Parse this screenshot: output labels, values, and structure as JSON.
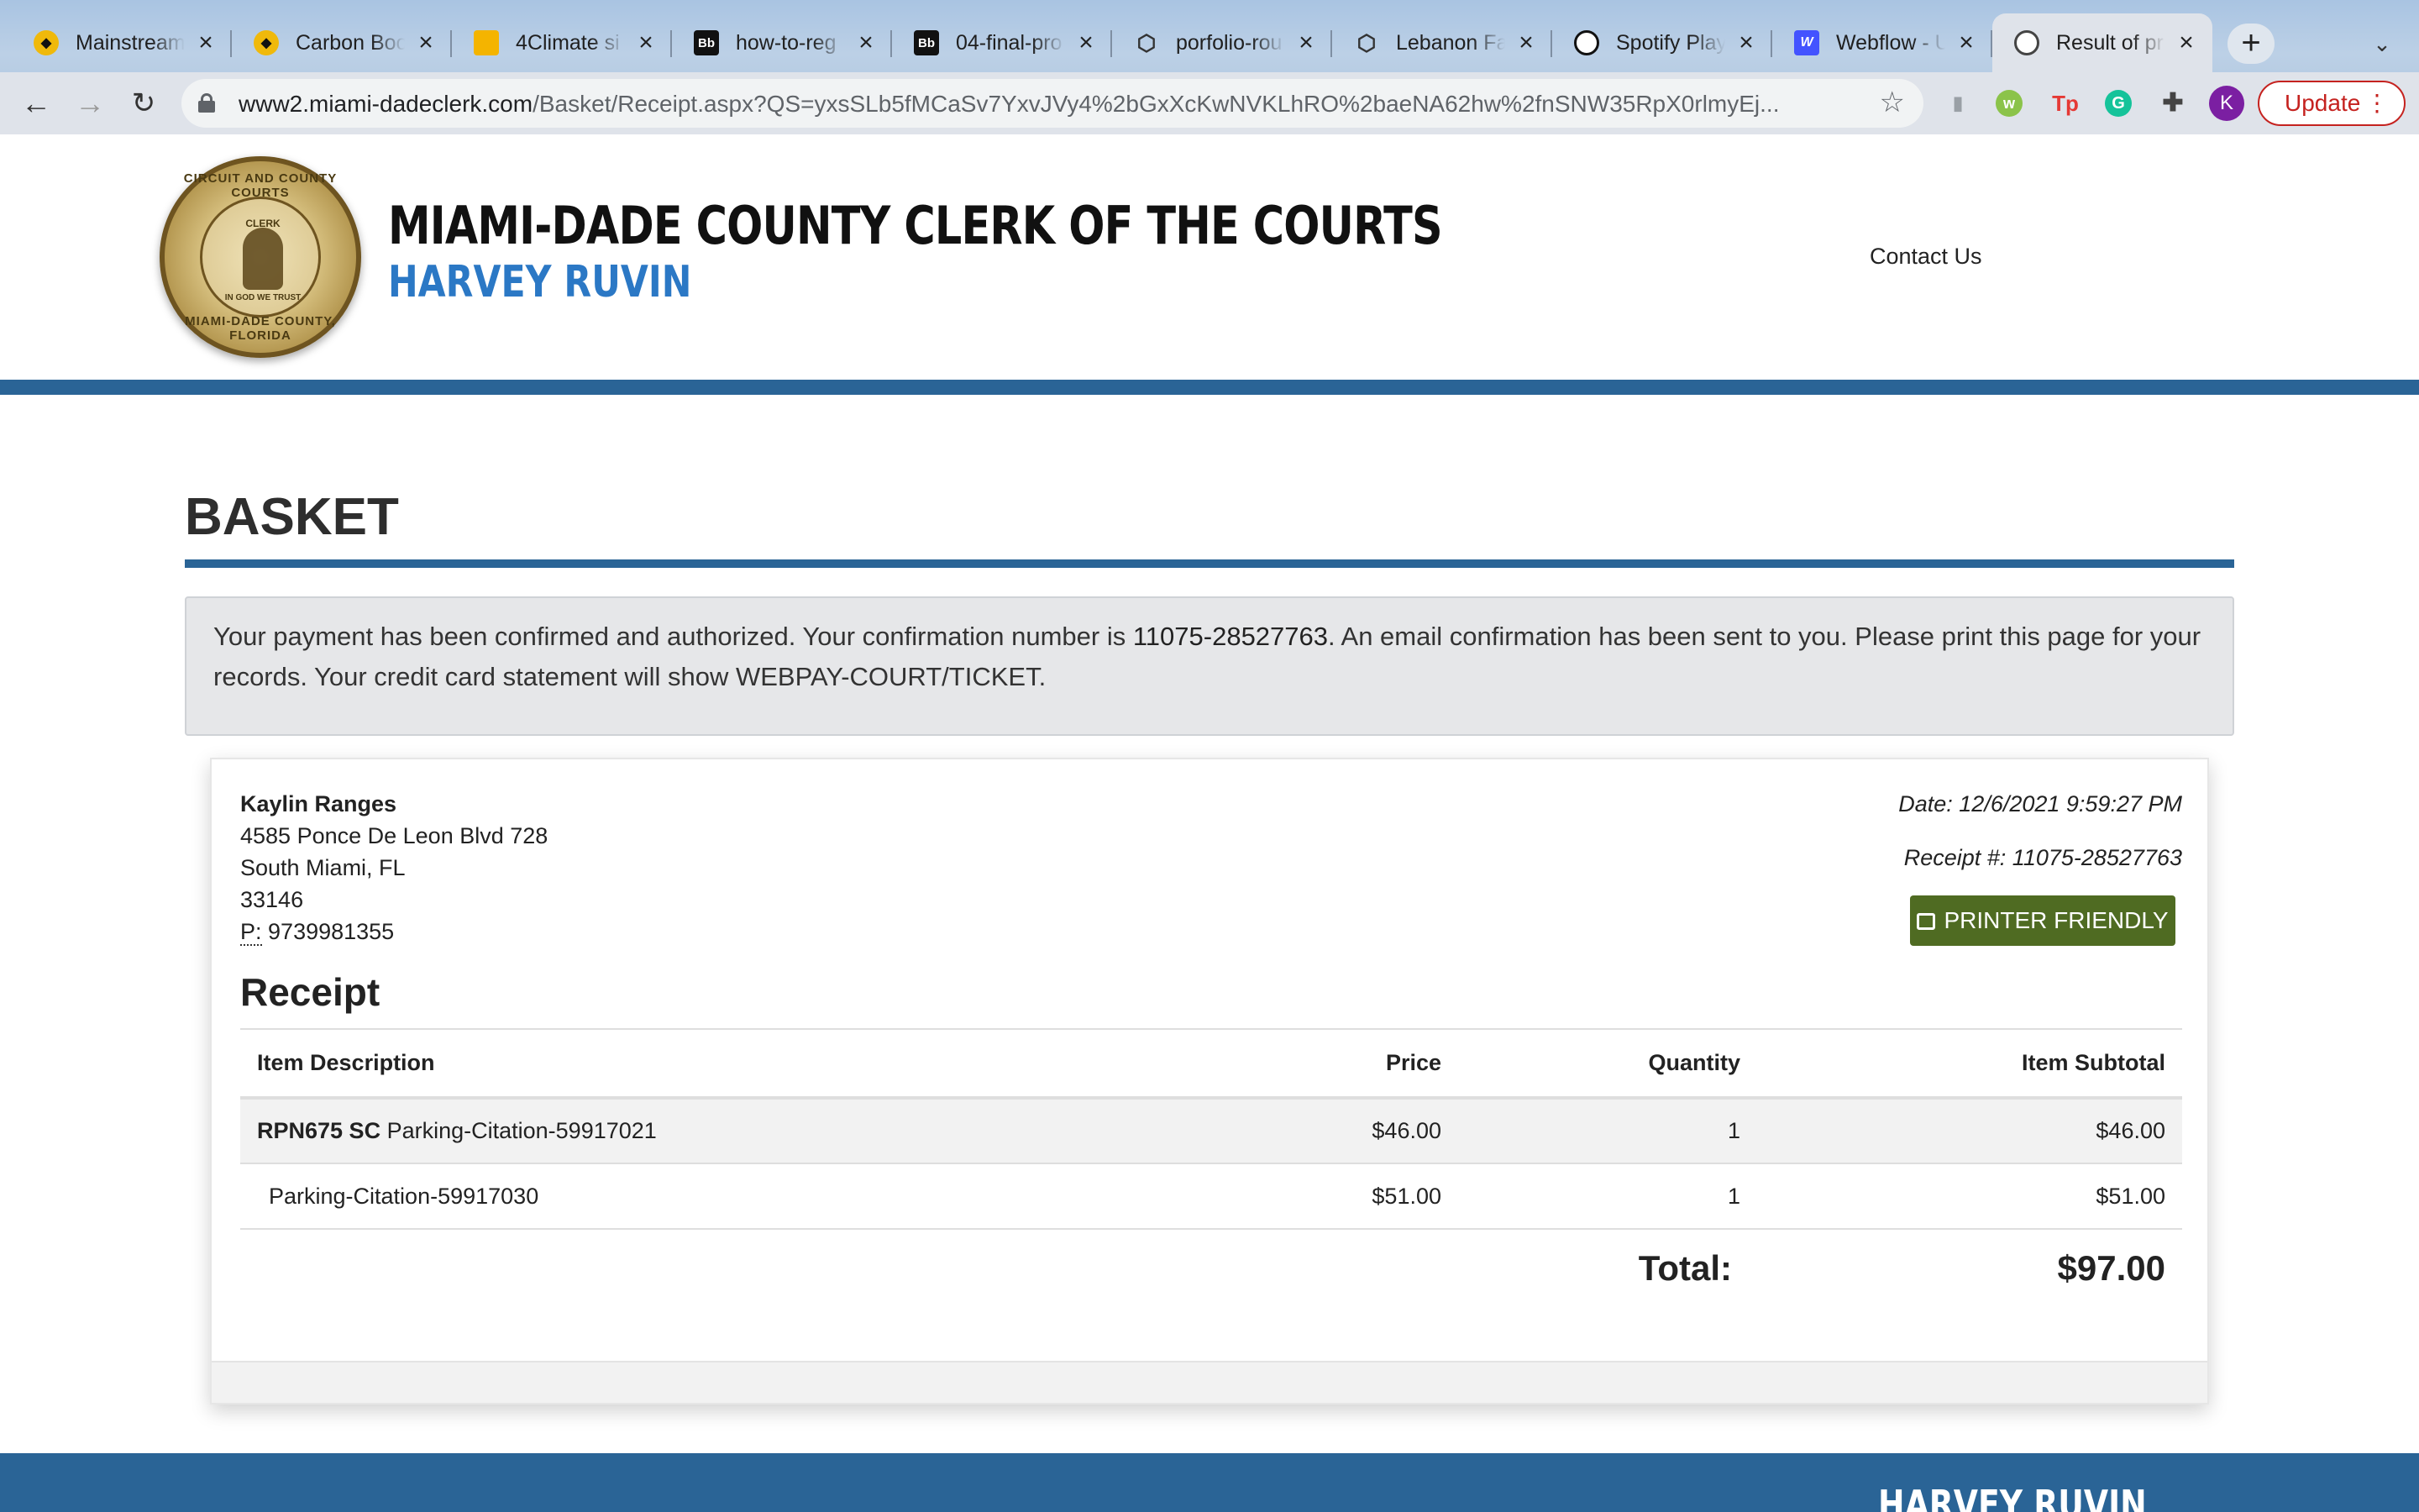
{
  "browser": {
    "tabs": [
      {
        "title": "Mainstream",
        "icon": "binance-icon",
        "active": false
      },
      {
        "title": "Carbon Boo",
        "icon": "binance-icon",
        "active": false
      },
      {
        "title": "4Climate si",
        "icon": "slides-icon",
        "active": false
      },
      {
        "title": "how-to-reg",
        "icon": "blackboard-icon",
        "active": false
      },
      {
        "title": "04-final-pro",
        "icon": "blackboard-icon",
        "active": false
      },
      {
        "title": "porfolio-rou",
        "icon": "codesandbox-icon",
        "active": false
      },
      {
        "title": "Lebanon Fa",
        "icon": "codesandbox-icon",
        "active": false
      },
      {
        "title": "Spotify Play",
        "icon": "codepen-icon",
        "active": false
      },
      {
        "title": "Webflow - U",
        "icon": "webflow-icon",
        "active": false
      },
      {
        "title": "Result of pr",
        "icon": "globe-icon",
        "active": true
      }
    ],
    "url_host": "www2.miami-dadeclerk.com",
    "url_path": "/Basket/Receipt.aspx?QS=yxsSLb5fMCaSv7YxvJVy4%2bGxXcKwNVKLhRO%2baeNA62hw%2fnSNW35RpX0rlmyEj...",
    "profile_initial": "K",
    "update_label": "Update",
    "new_tab_glyph": "+",
    "tab_search_glyph": "⌄"
  },
  "site": {
    "title": "MIAMI-DADE COUNTY CLERK OF THE COURTS",
    "subtitle": "HARVEY RUVIN",
    "contact_label": "Contact Us",
    "seal": {
      "ring_top": "CIRCUIT AND COUNTY COURTS",
      "ring_bottom": "MIAMI-DADE COUNTY, FLORIDA",
      "center_top": "CLERK",
      "center_bottom": "IN GOD WE TRUST"
    },
    "brand_color": "#2a6496"
  },
  "page": {
    "heading": "BASKET",
    "alert": {
      "before": "Your payment has been confirmed and authorized. Your confirmation number is ",
      "confirmation_number": "11075-28527763",
      "after": ". An email confirmation has been sent to you. Please print this page for your records. Your credit card statement will show WEBPAY-COURT/TICKET."
    }
  },
  "receipt": {
    "customer": {
      "name": "Kaylin Ranges",
      "address": "4585 Ponce De Leon Blvd 728",
      "city_state": "South Miami, FL",
      "zip": "33146",
      "phone_label": "P:",
      "phone": "9739981355"
    },
    "date_line": "Date: 12/6/2021 9:59:27 PM",
    "receipt_line": "Receipt #: 11075-28527763",
    "print_label": "PRINTER FRIENDLY",
    "title": "Receipt",
    "columns": [
      "Item Description",
      "Price",
      "Quantity",
      "Item Subtotal"
    ],
    "rows": [
      {
        "ticket": "RPN675 SC",
        "description": "Parking-Citation-59917021",
        "price": "$46.00",
        "quantity": "1",
        "subtotal": "$46.00"
      },
      {
        "ticket": "",
        "description": "Parking-Citation-59917030",
        "price": "$51.00",
        "quantity": "1",
        "subtotal": "$51.00"
      }
    ],
    "total_label": "Total:",
    "total": "$97.00"
  },
  "footer": {
    "name": "HARVEY RUVIN"
  }
}
